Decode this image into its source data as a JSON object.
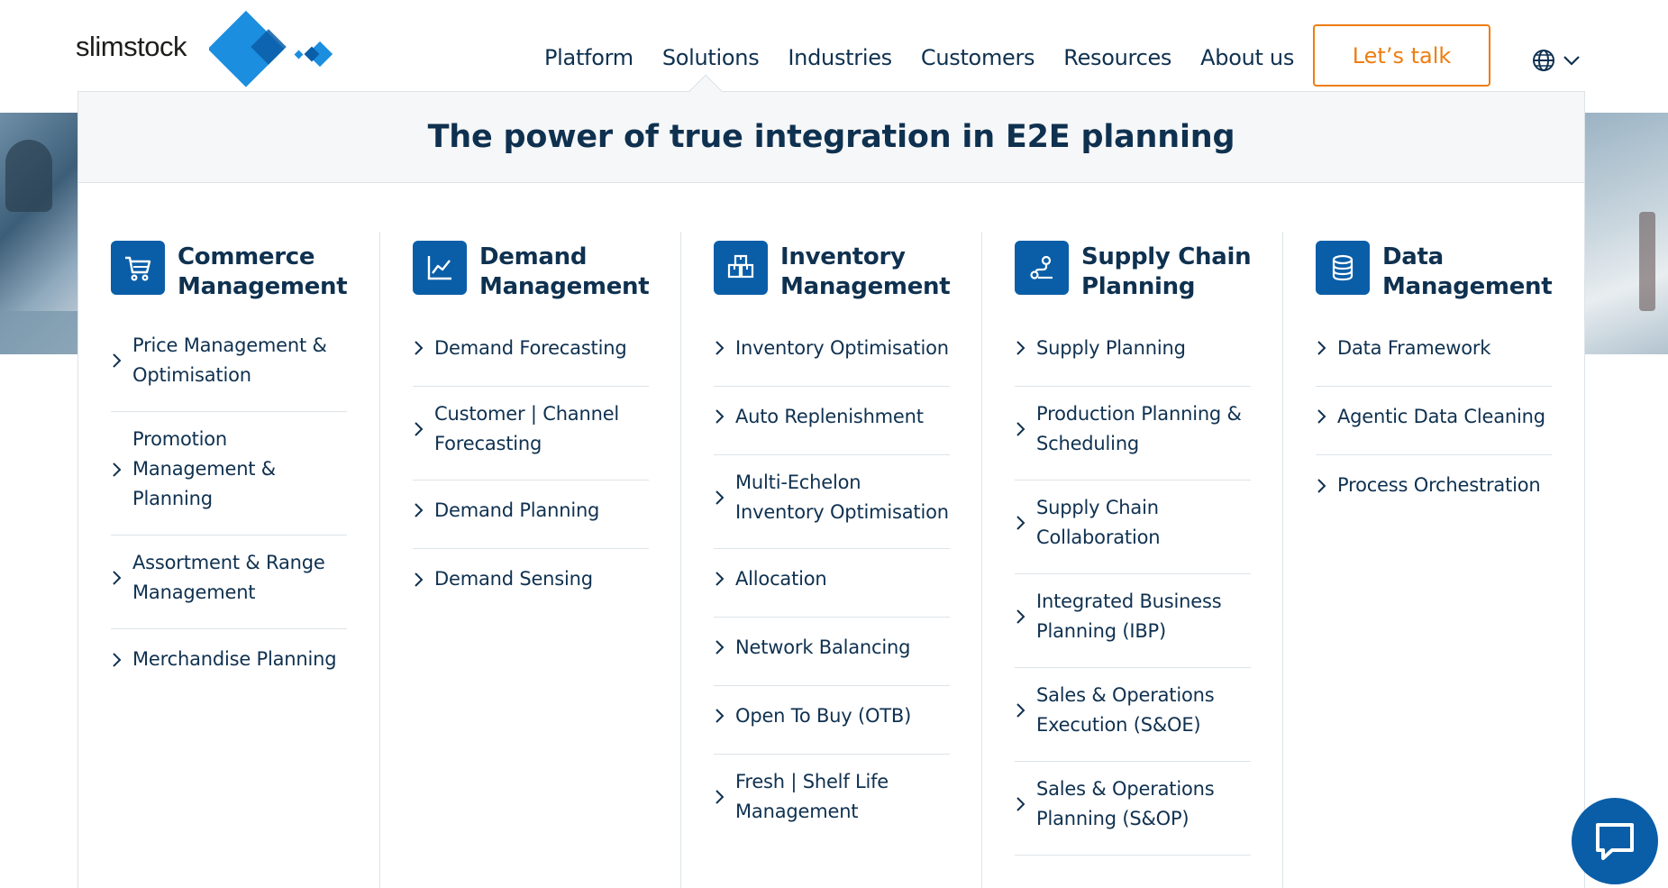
{
  "brand": {
    "logo_text": "slimstock",
    "primary_color": "#0a5ea8",
    "accent_color": "#ee7d11",
    "text_color": "#0f3150"
  },
  "nav": {
    "items": [
      "Platform",
      "Solutions",
      "Industries",
      "Customers",
      "Resources",
      "About us"
    ],
    "active": "Solutions",
    "cta_label": "Let’s talk",
    "language_icon": "globe-icon"
  },
  "mega_menu": {
    "title": "The power of true integration in E2E planning",
    "columns": [
      {
        "title": "Commerce Management",
        "icon": "shopping-cart-icon",
        "items": [
          "Price Management & Optimisation",
          "Promotion Management & Planning",
          "Assortment & Range Management",
          "Merchandise Planning"
        ]
      },
      {
        "title": "Demand Management",
        "icon": "line-chart-icon",
        "items": [
          "Demand Forecasting",
          "Customer | Channel Forecasting",
          "Demand Planning",
          "Demand Sensing"
        ]
      },
      {
        "title": "Inventory Management",
        "icon": "boxes-icon",
        "items": [
          "Inventory Optimisation",
          "Auto Replenishment",
          "Multi-Echelon Inventory Optimisation",
          "Allocation",
          "Network Balancing",
          "Open To Buy (OTB)",
          "Fresh | Shelf Life Management"
        ]
      },
      {
        "title": "Supply Chain Planning",
        "icon": "route-icon",
        "items": [
          "Supply Planning",
          "Production Planning & Scheduling",
          "Supply Chain Collaboration",
          "Integrated Business Planning (IBP)",
          "Sales & Operations Execution (S&OE)",
          "Sales & Operations Planning (S&OP)"
        ]
      },
      {
        "title": "Data Management",
        "icon": "database-icon",
        "items": [
          "Data Framework",
          "Agentic Data Cleaning",
          "Process Orchestration"
        ]
      }
    ]
  },
  "chat": {
    "icon": "chat-bubble-icon"
  }
}
